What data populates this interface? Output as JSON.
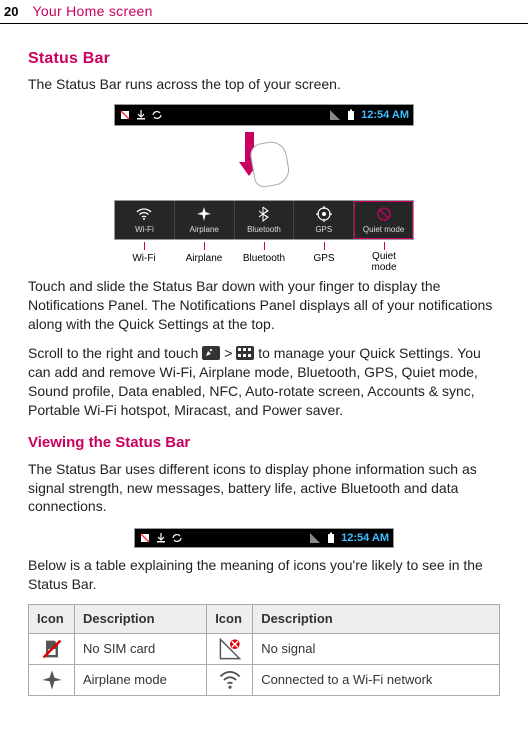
{
  "header": {
    "page_number": "20",
    "chapter_title": "Your Home screen"
  },
  "section1": {
    "heading": "Status Bar",
    "intro": "The Status Bar runs across the top of your screen."
  },
  "statusbar": {
    "time": "12:54 AM"
  },
  "quick_settings": {
    "items": [
      {
        "label": "Wi-Fi"
      },
      {
        "label": "Airplane"
      },
      {
        "label": "Bluetooth"
      },
      {
        "label": "GPS"
      },
      {
        "label": "Quiet mode"
      }
    ]
  },
  "callouts": {
    "c0": "Wi-Fi",
    "c1": "Airplane",
    "c2": "Bluetooth",
    "c3": "GPS",
    "c4a": "Quiet",
    "c4b": "mode"
  },
  "para1": "Touch and slide the Status Bar down with your finger to display the Notifications Panel. The Notifications Panel displays all of your notifications along with the Quick Settings at the top.",
  "para2a": "Scroll to the right and touch ",
  "para2b": " > ",
  "para2c": " to manage your Quick Settings. You can add and remove Wi-Fi, Airplane mode, Bluetooth, GPS, Quiet mode, Sound profile, Data enabled, NFC, Auto-rotate screen, Accounts & sync, Portable Wi-Fi hotspot, Miracast, and Power saver.",
  "section2": {
    "heading": "Viewing the Status Bar",
    "intro": "The Status Bar uses different icons to display phone information such as signal strength, new messages, battery life, active Bluetooth and data connections.",
    "after_bar": "Below is a table explaining the meaning of icons you're likely to see in the Status Bar."
  },
  "table": {
    "h_icon": "Icon",
    "h_desc": "Description",
    "r1c1": "No SIM card",
    "r1c2": "No signal",
    "r2c1": "Airplane mode",
    "r2c2": "Connected to a Wi-Fi network"
  }
}
